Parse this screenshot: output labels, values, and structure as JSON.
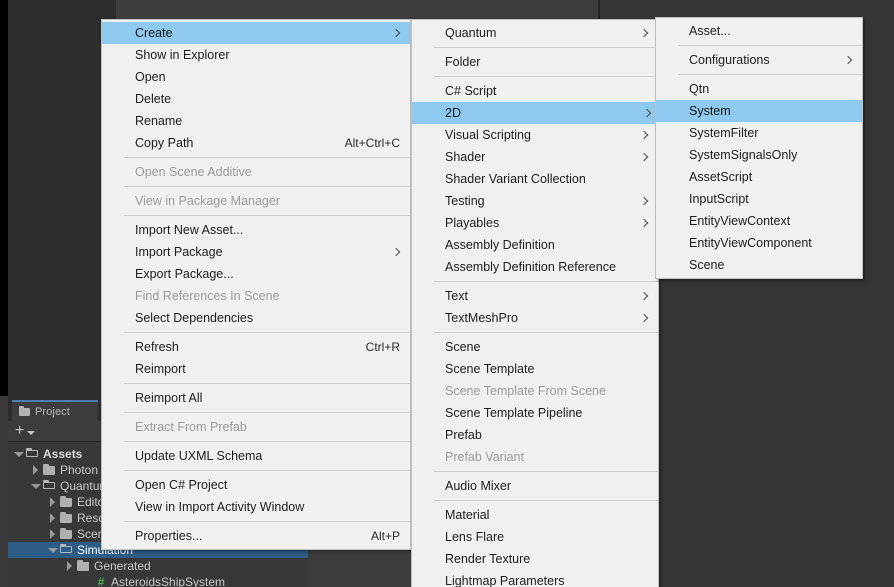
{
  "app": "Unity Editor",
  "project_panel": {
    "tab_label": "Project",
    "tab_icon": "folder-icon",
    "toolbar": {
      "add_icon": "plus-icon",
      "dropdown_icon": "chevron-down-icon"
    },
    "tree": [
      {
        "label": "Assets",
        "indent": 0,
        "expanded": true,
        "type": "folder",
        "bold": true,
        "selected": false
      },
      {
        "label": "Photon",
        "indent": 1,
        "expanded": false,
        "type": "folder",
        "bold": false,
        "selected": false
      },
      {
        "label": "Quantum",
        "indent": 1,
        "expanded": true,
        "type": "folder",
        "bold": false,
        "selected": false
      },
      {
        "label": "Editor",
        "indent": 2,
        "expanded": false,
        "type": "folder",
        "bold": false,
        "selected": false
      },
      {
        "label": "Resources",
        "indent": 2,
        "expanded": false,
        "type": "folder",
        "bold": false,
        "selected": false
      },
      {
        "label": "Scenes",
        "indent": 2,
        "expanded": false,
        "type": "folder",
        "bold": false,
        "selected": false
      },
      {
        "label": "Simulation",
        "indent": 2,
        "expanded": true,
        "type": "folder",
        "bold": false,
        "selected": true
      },
      {
        "label": "Generated",
        "indent": 3,
        "expanded": false,
        "type": "folder",
        "bold": false,
        "selected": false
      },
      {
        "label": "AsteroidsShipSystem",
        "indent": 4,
        "expanded": null,
        "type": "script",
        "bold": false,
        "selected": false
      }
    ]
  },
  "colors": {
    "menu_bg": "#f0f0f0",
    "menu_border": "#bfbfbf",
    "highlight": "#8ec9f0",
    "text": "#1d1d1d",
    "text_disabled": "#9a9a9a",
    "separator": "#d0d0d0",
    "editor_bg": "#3d3d3d",
    "panel_bg": "#383838",
    "tree_selected": "#2c5d87",
    "tab_accent": "#4a7fb5"
  },
  "menus": [
    {
      "id": "menu-context",
      "name": "asset-context-menu",
      "items": [
        {
          "label": "Create",
          "submenu": true,
          "disabled": false,
          "highlighted": true,
          "shortcut": ""
        },
        {
          "label": "Show in Explorer",
          "submenu": false,
          "disabled": false,
          "highlighted": false,
          "shortcut": ""
        },
        {
          "label": "Open",
          "submenu": false,
          "disabled": false,
          "highlighted": false,
          "shortcut": ""
        },
        {
          "label": "Delete",
          "submenu": false,
          "disabled": false,
          "highlighted": false,
          "shortcut": ""
        },
        {
          "label": "Rename",
          "submenu": false,
          "disabled": false,
          "highlighted": false,
          "shortcut": ""
        },
        {
          "label": "Copy Path",
          "submenu": false,
          "disabled": false,
          "highlighted": false,
          "shortcut": "Alt+Ctrl+C"
        },
        {
          "separator": true
        },
        {
          "label": "Open Scene Additive",
          "submenu": false,
          "disabled": true,
          "highlighted": false,
          "shortcut": ""
        },
        {
          "separator": true
        },
        {
          "label": "View in Package Manager",
          "submenu": false,
          "disabled": true,
          "highlighted": false,
          "shortcut": ""
        },
        {
          "separator": true
        },
        {
          "label": "Import New Asset...",
          "submenu": false,
          "disabled": false,
          "highlighted": false,
          "shortcut": ""
        },
        {
          "label": "Import Package",
          "submenu": true,
          "disabled": false,
          "highlighted": false,
          "shortcut": ""
        },
        {
          "label": "Export Package...",
          "submenu": false,
          "disabled": false,
          "highlighted": false,
          "shortcut": ""
        },
        {
          "label": "Find References In Scene",
          "submenu": false,
          "disabled": true,
          "highlighted": false,
          "shortcut": ""
        },
        {
          "label": "Select Dependencies",
          "submenu": false,
          "disabled": false,
          "highlighted": false,
          "shortcut": ""
        },
        {
          "separator": true
        },
        {
          "label": "Refresh",
          "submenu": false,
          "disabled": false,
          "highlighted": false,
          "shortcut": "Ctrl+R"
        },
        {
          "label": "Reimport",
          "submenu": false,
          "disabled": false,
          "highlighted": false,
          "shortcut": ""
        },
        {
          "separator": true
        },
        {
          "label": "Reimport All",
          "submenu": false,
          "disabled": false,
          "highlighted": false,
          "shortcut": ""
        },
        {
          "separator": true
        },
        {
          "label": "Extract From Prefab",
          "submenu": false,
          "disabled": true,
          "highlighted": false,
          "shortcut": ""
        },
        {
          "separator": true
        },
        {
          "label": "Update UXML Schema",
          "submenu": false,
          "disabled": false,
          "highlighted": false,
          "shortcut": ""
        },
        {
          "separator": true
        },
        {
          "label": "Open C# Project",
          "submenu": false,
          "disabled": false,
          "highlighted": false,
          "shortcut": ""
        },
        {
          "label": "View in Import Activity Window",
          "submenu": false,
          "disabled": false,
          "highlighted": false,
          "shortcut": ""
        },
        {
          "separator": true
        },
        {
          "label": "Properties...",
          "submenu": false,
          "disabled": false,
          "highlighted": false,
          "shortcut": "Alt+P"
        }
      ]
    },
    {
      "id": "menu-create",
      "name": "create-submenu",
      "items": [
        {
          "label": "Quantum",
          "submenu": true,
          "disabled": false,
          "highlighted": false,
          "shortcut": ""
        },
        {
          "separator": true
        },
        {
          "label": "Folder",
          "submenu": false,
          "disabled": false,
          "highlighted": false,
          "shortcut": ""
        },
        {
          "separator": true
        },
        {
          "label": "C# Script",
          "submenu": false,
          "disabled": false,
          "highlighted": false,
          "shortcut": ""
        },
        {
          "label": "2D",
          "submenu": true,
          "disabled": false,
          "highlighted": true,
          "shortcut": ""
        },
        {
          "label": "Visual Scripting",
          "submenu": true,
          "disabled": false,
          "highlighted": false,
          "shortcut": ""
        },
        {
          "label": "Shader",
          "submenu": true,
          "disabled": false,
          "highlighted": false,
          "shortcut": ""
        },
        {
          "label": "Shader Variant Collection",
          "submenu": false,
          "disabled": false,
          "highlighted": false,
          "shortcut": ""
        },
        {
          "label": "Testing",
          "submenu": true,
          "disabled": false,
          "highlighted": false,
          "shortcut": ""
        },
        {
          "label": "Playables",
          "submenu": true,
          "disabled": false,
          "highlighted": false,
          "shortcut": ""
        },
        {
          "label": "Assembly Definition",
          "submenu": false,
          "disabled": false,
          "highlighted": false,
          "shortcut": ""
        },
        {
          "label": "Assembly Definition Reference",
          "submenu": false,
          "disabled": false,
          "highlighted": false,
          "shortcut": ""
        },
        {
          "separator": true
        },
        {
          "label": "Text",
          "submenu": true,
          "disabled": false,
          "highlighted": false,
          "shortcut": ""
        },
        {
          "label": "TextMeshPro",
          "submenu": true,
          "disabled": false,
          "highlighted": false,
          "shortcut": ""
        },
        {
          "separator": true
        },
        {
          "label": "Scene",
          "submenu": false,
          "disabled": false,
          "highlighted": false,
          "shortcut": ""
        },
        {
          "label": "Scene Template",
          "submenu": false,
          "disabled": false,
          "highlighted": false,
          "shortcut": ""
        },
        {
          "label": "Scene Template From Scene",
          "submenu": false,
          "disabled": true,
          "highlighted": false,
          "shortcut": ""
        },
        {
          "label": "Scene Template Pipeline",
          "submenu": false,
          "disabled": false,
          "highlighted": false,
          "shortcut": ""
        },
        {
          "label": "Prefab",
          "submenu": false,
          "disabled": false,
          "highlighted": false,
          "shortcut": ""
        },
        {
          "label": "Prefab Variant",
          "submenu": false,
          "disabled": true,
          "highlighted": false,
          "shortcut": ""
        },
        {
          "separator": true
        },
        {
          "label": "Audio Mixer",
          "submenu": false,
          "disabled": false,
          "highlighted": false,
          "shortcut": ""
        },
        {
          "separator": true
        },
        {
          "label": "Material",
          "submenu": false,
          "disabled": false,
          "highlighted": false,
          "shortcut": ""
        },
        {
          "label": "Lens Flare",
          "submenu": false,
          "disabled": false,
          "highlighted": false,
          "shortcut": ""
        },
        {
          "label": "Render Texture",
          "submenu": false,
          "disabled": false,
          "highlighted": false,
          "shortcut": ""
        },
        {
          "label": "Lightmap Parameters",
          "submenu": false,
          "disabled": false,
          "highlighted": false,
          "shortcut": ""
        }
      ]
    },
    {
      "id": "menu-2d",
      "name": "quantum-2d-submenu",
      "items": [
        {
          "label": "Asset...",
          "submenu": false,
          "disabled": false,
          "highlighted": false,
          "shortcut": ""
        },
        {
          "separator": true
        },
        {
          "label": "Configurations",
          "submenu": true,
          "disabled": false,
          "highlighted": false,
          "shortcut": ""
        },
        {
          "separator": true
        },
        {
          "label": "Qtn",
          "submenu": false,
          "disabled": false,
          "highlighted": false,
          "shortcut": ""
        },
        {
          "label": "System",
          "submenu": false,
          "disabled": false,
          "highlighted": true,
          "shortcut": ""
        },
        {
          "label": "SystemFilter",
          "submenu": false,
          "disabled": false,
          "highlighted": false,
          "shortcut": ""
        },
        {
          "label": "SystemSignalsOnly",
          "submenu": false,
          "disabled": false,
          "highlighted": false,
          "shortcut": ""
        },
        {
          "label": "AssetScript",
          "submenu": false,
          "disabled": false,
          "highlighted": false,
          "shortcut": ""
        },
        {
          "label": "InputScript",
          "submenu": false,
          "disabled": false,
          "highlighted": false,
          "shortcut": ""
        },
        {
          "label": "EntityViewContext",
          "submenu": false,
          "disabled": false,
          "highlighted": false,
          "shortcut": ""
        },
        {
          "label": "EntityViewComponent",
          "submenu": false,
          "disabled": false,
          "highlighted": false,
          "shortcut": ""
        },
        {
          "label": "Scene",
          "submenu": false,
          "disabled": false,
          "highlighted": false,
          "shortcut": ""
        }
      ]
    }
  ]
}
